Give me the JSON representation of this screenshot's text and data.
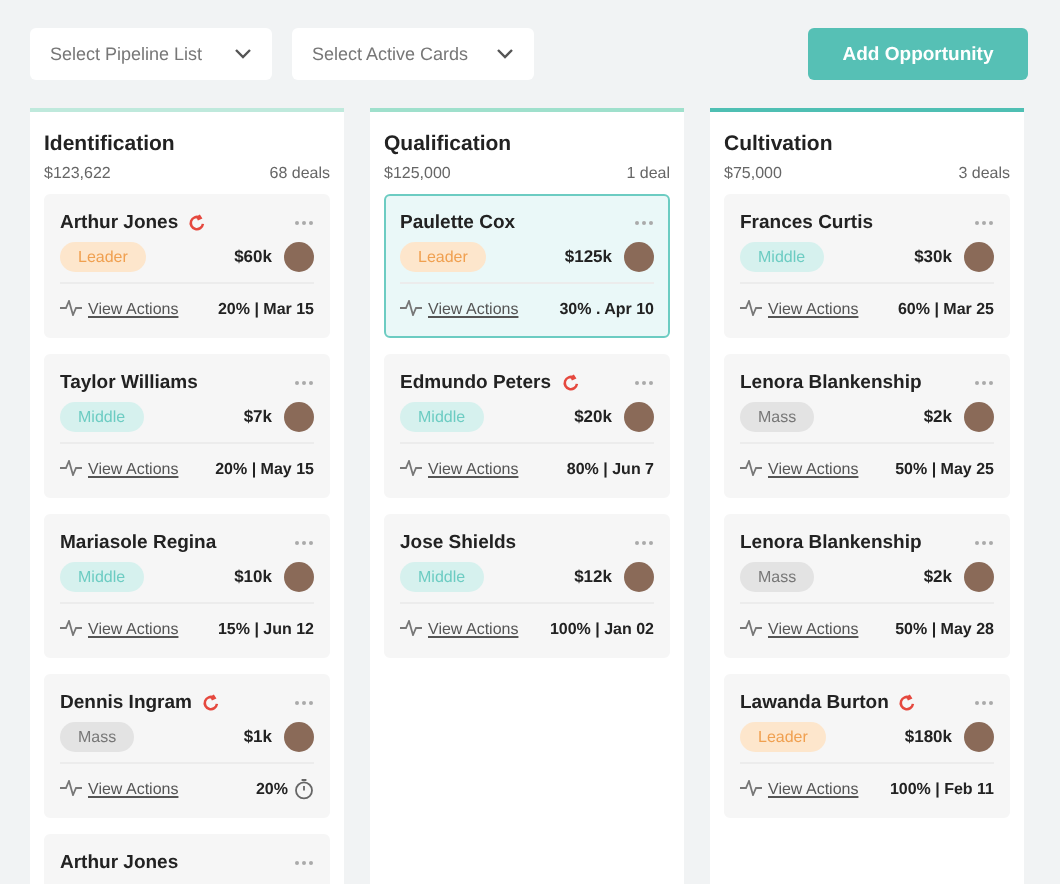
{
  "filters": [
    {
      "placeholder": "Select Pipeline List"
    },
    {
      "placeholder": "Select Active Cards"
    }
  ],
  "add_button": {
    "label": "Add Opportunity"
  },
  "columns": [
    {
      "title": "Identification",
      "total": "$123,622",
      "count": "68 deals",
      "color": "#bfe9dc",
      "cards": [
        {
          "name": "Arthur Jones",
          "alert": true,
          "selected": false,
          "tag": {
            "label": "Leader",
            "kind": "leader"
          },
          "amount": "$60k",
          "link": "View Actions",
          "stat": "20% | Mar 15",
          "timer": false
        },
        {
          "name": "Taylor Williams",
          "alert": false,
          "selected": false,
          "tag": {
            "label": "Middle",
            "kind": "middle"
          },
          "amount": "$7k",
          "link": "View Actions",
          "stat": "20% | May 15",
          "timer": false
        },
        {
          "name": "Mariasole Regina",
          "alert": false,
          "selected": false,
          "tag": {
            "label": "Middle",
            "kind": "middle"
          },
          "amount": "$10k",
          "link": "View Actions",
          "stat": "15% | Jun 12",
          "timer": false
        },
        {
          "name": "Dennis Ingram",
          "alert": true,
          "selected": false,
          "tag": {
            "label": "Mass",
            "kind": "mass"
          },
          "amount": "$1k",
          "link": "View Actions",
          "stat": "20%",
          "timer": true
        },
        {
          "name": "Arthur Jones",
          "alert": false,
          "selected": false
        }
      ]
    },
    {
      "title": "Qualification",
      "total": "$125,000",
      "count": "1 deal",
      "color": "#9fe0cc",
      "cards": [
        {
          "name": "Paulette Cox",
          "alert": false,
          "selected": true,
          "tag": {
            "label": "Leader",
            "kind": "leader"
          },
          "amount": "$125k",
          "link": "View Actions",
          "stat": "30% . Apr 10",
          "timer": false
        },
        {
          "name": "Edmundo Peters",
          "alert": true,
          "selected": false,
          "tag": {
            "label": "Middle",
            "kind": "middle"
          },
          "amount": "$20k",
          "link": "View Actions",
          "stat": "80% | Jun 7",
          "timer": false
        },
        {
          "name": "Jose Shields",
          "alert": false,
          "selected": false,
          "tag": {
            "label": "Middle",
            "kind": "middle"
          },
          "amount": "$12k",
          "link": "View Actions",
          "stat": "100% | Jan 02",
          "timer": false
        }
      ]
    },
    {
      "title": "Cultivation",
      "total": "$75,000",
      "count": "3 deals",
      "color": "#4fbfb3",
      "cards": [
        {
          "name": "Frances Curtis",
          "alert": false,
          "selected": false,
          "tag": {
            "label": "Middle",
            "kind": "middle"
          },
          "amount": "$30k",
          "link": "View Actions",
          "stat": "60% | Mar 25",
          "timer": false
        },
        {
          "name": "Lenora Blankenship",
          "alert": false,
          "selected": false,
          "tag": {
            "label": "Mass",
            "kind": "mass"
          },
          "amount": "$2k",
          "link": "View Actions",
          "stat": "50% | May 25",
          "timer": false
        },
        {
          "name": "Lenora Blankenship",
          "alert": false,
          "selected": false,
          "tag": {
            "label": "Mass",
            "kind": "mass"
          },
          "amount": "$2k",
          "link": "View Actions",
          "stat": "50% | May 28",
          "timer": false
        },
        {
          "name": "Lawanda Burton",
          "alert": true,
          "selected": false,
          "tag": {
            "label": "Leader",
            "kind": "leader"
          },
          "amount": "$180k",
          "link": "View Actions",
          "stat": "100% | Feb 11",
          "timer": false
        }
      ]
    }
  ]
}
